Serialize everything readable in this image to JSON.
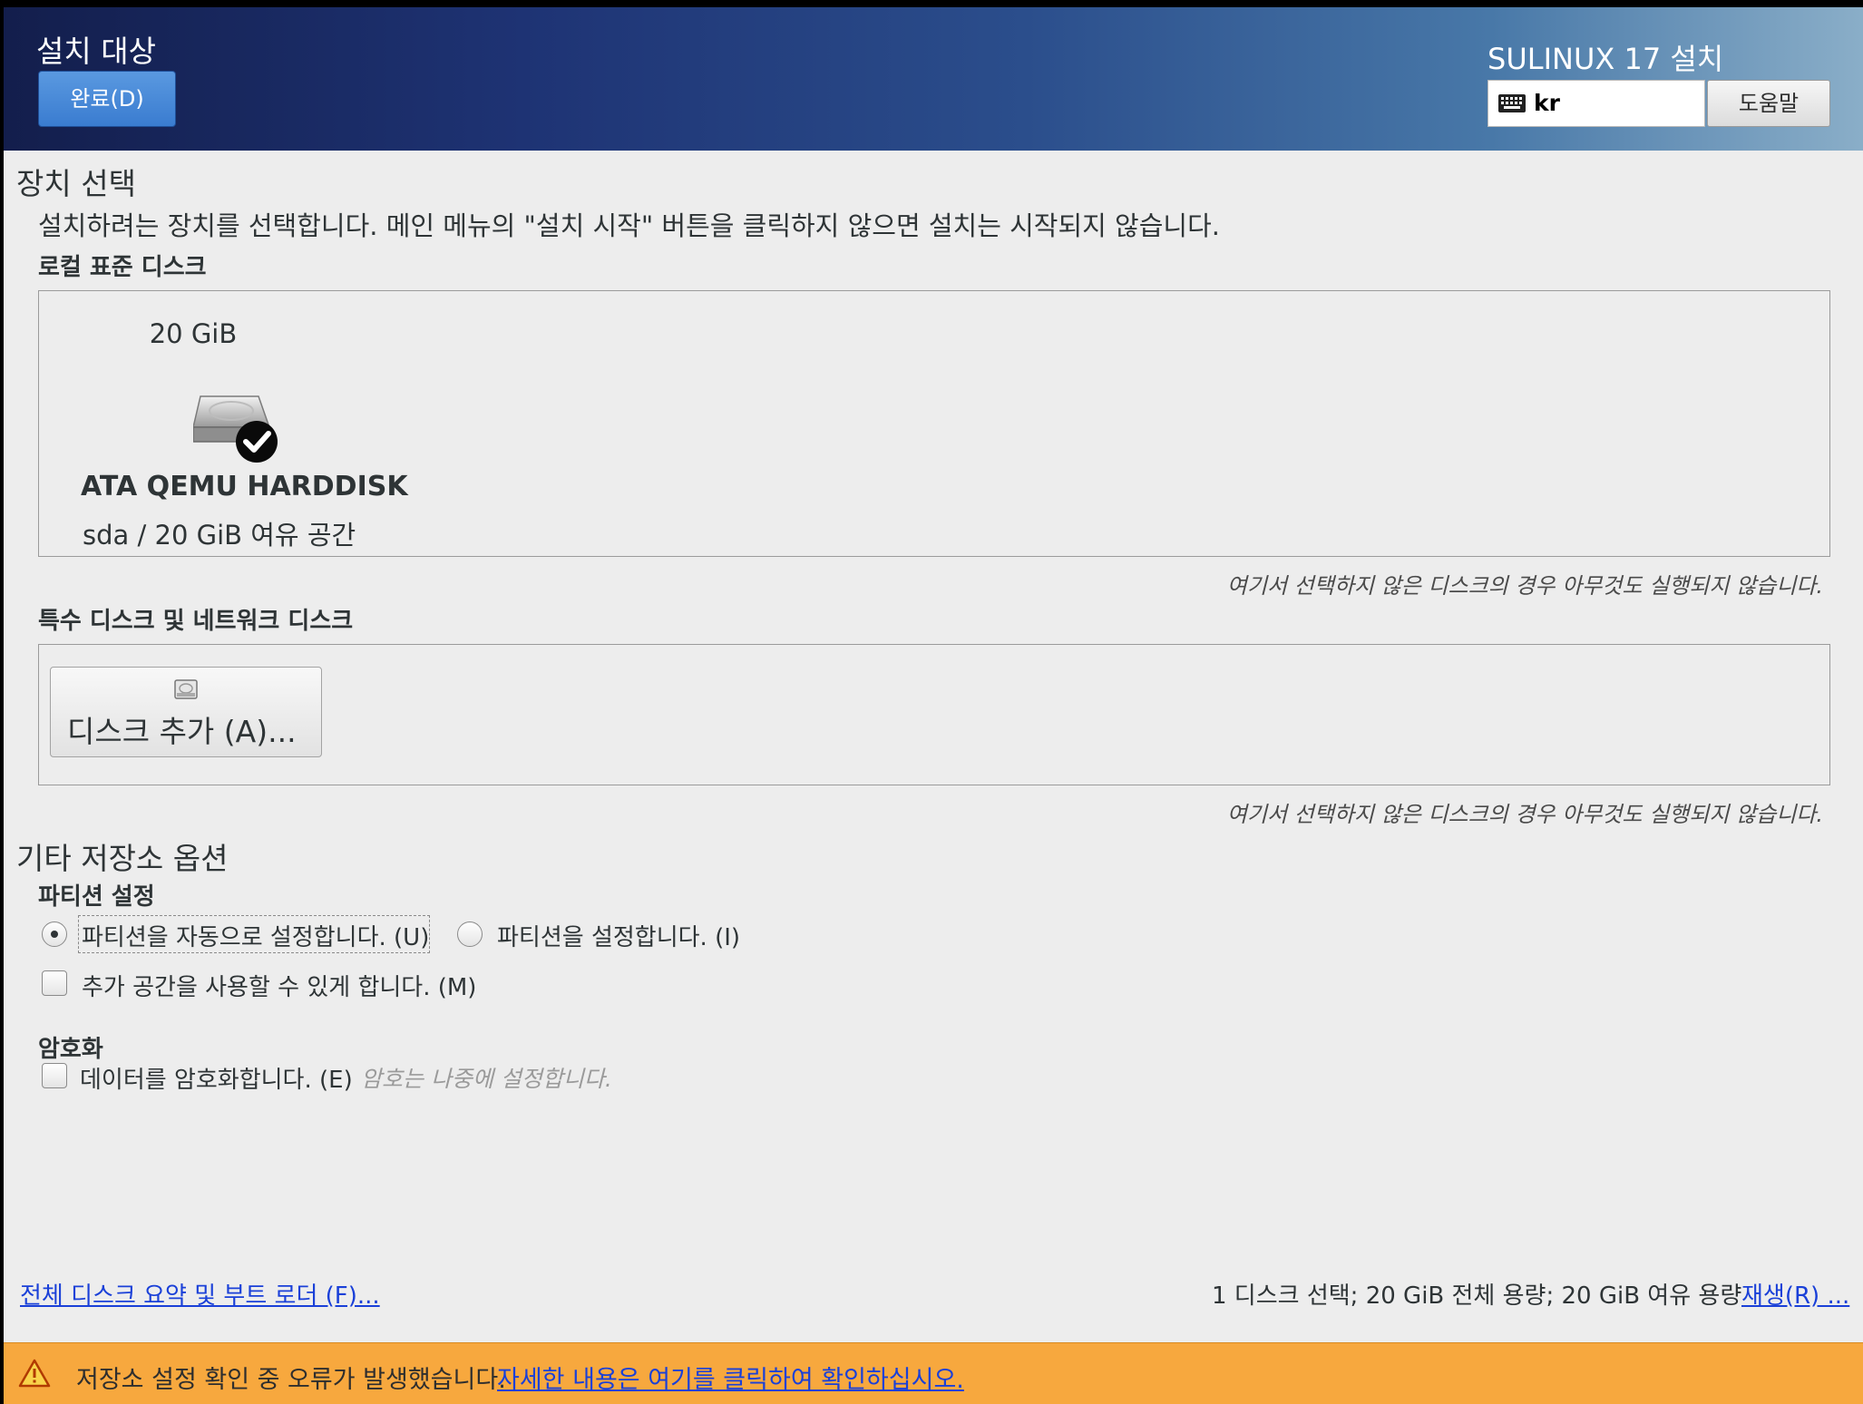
{
  "header": {
    "spoke_title": "설치 대상",
    "done_label": "완료(D)",
    "product_title": "SULINUX 17 설치",
    "keyboard_layout": "kr",
    "help_label": "도움말"
  },
  "device_selection": {
    "title": "장치 선택",
    "description": "설치하려는 장치를 선택합니다. 메인 메뉴의 \"설치 시작\" 버튼을 클릭하지 않으면 설치는 시작되지 않습니다.",
    "local_disks_label": "로컬 표준 디스크",
    "disk": {
      "size": "20 GiB",
      "name": "ATA QEMU HARDDISK",
      "info": "sda  /  20 GiB 여유 공간",
      "selected": true
    },
    "local_hint": "여기서 선택하지 않은 디스크의 경우 아무것도 실행되지 않습니다.",
    "special_disks_label": "특수 디스크 및 네트워크 디스크",
    "add_disk_label": "디스크 추가 (A)...",
    "special_hint": "여기서 선택하지 않은 디스크의 경우 아무것도 실행되지 않습니다."
  },
  "other_options": {
    "title": "기타 저장소 옵션",
    "partitioning_label": "파티션 설정",
    "auto_partition": "파티션을 자동으로 설정합니다. (U)",
    "manual_partition": "파티션을 설정합니다. (I)",
    "selected_partitioning": "auto",
    "extra_space": "추가 공간을 사용할 수 있게 합니다. (M)",
    "encryption_label": "암호화",
    "encrypt_data": "데이터를 암호화합니다. (E)",
    "encrypt_hint": "암호는 나중에 설정합니다."
  },
  "footer": {
    "summary_link": "전체 디스크 요약 및 부트 로더 (F)...",
    "status": "1 디스크 선택; 20 GiB 전체 용량; 20 GiB 여유 용량",
    "refresh_link": "재생(R) ..."
  },
  "warning": {
    "message": "저장소 설정 확인 중 오류가 발생했습니다.",
    "link": "자세한 내용은 여기를 클릭하여 확인하십시오."
  },
  "colors": {
    "header_start": "#131e4c",
    "header_end": "#8aaec8",
    "done_button": "#3a7cd0",
    "warning_bar": "#f7a83e",
    "link": "#1a40d8"
  }
}
